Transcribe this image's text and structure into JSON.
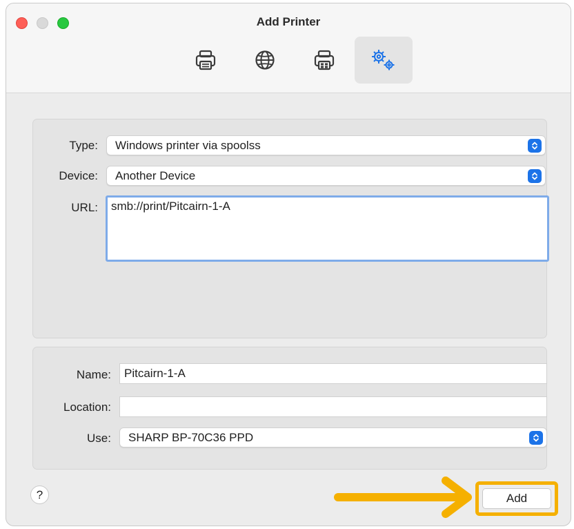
{
  "window": {
    "title": "Add Printer"
  },
  "toolbar": {
    "buttons": [
      {
        "icon": "printer-icon",
        "selected": false
      },
      {
        "icon": "globe-icon",
        "selected": false
      },
      {
        "icon": "windows-printer-icon",
        "selected": false
      },
      {
        "icon": "advanced-gears-icon",
        "selected": true
      }
    ]
  },
  "connection": {
    "type_label": "Type:",
    "type_value": "Windows printer via spoolss",
    "device_label": "Device:",
    "device_value": "Another Device",
    "url_label": "URL:",
    "url_value": "smb://print/Pitcairn-1-A"
  },
  "printer": {
    "name_label": "Name:",
    "name_value": "Pitcairn-1-A",
    "location_label": "Location:",
    "location_value": "",
    "use_label": "Use:",
    "use_value": "SHARP BP-70C36 PPD"
  },
  "footer": {
    "help_label": "?",
    "add_label": "Add"
  },
  "colors": {
    "accent": "#1c73e8",
    "annotation": "#f5b000",
    "focus_ring": "#7eabe9"
  }
}
